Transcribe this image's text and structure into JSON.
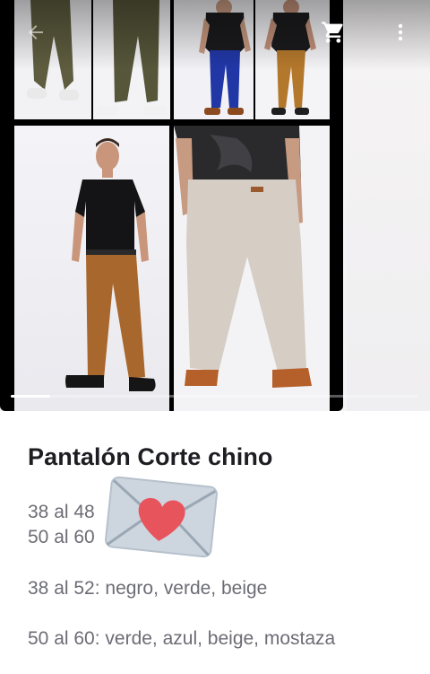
{
  "app": {
    "icons": {
      "back": "arrow-back-icon",
      "cart": "shopping-cart-icon",
      "more": "more-vert-icon"
    }
  },
  "gallery": {
    "slide_index": 1,
    "panels": [
      {
        "name": "olive-pants-sneakers",
        "shirt": "none",
        "pants": "#5e5d3f",
        "shoes": "#e9e9e9"
      },
      {
        "name": "olive-pants-white-shoes",
        "shirt": "none",
        "pants": "#56563a",
        "shoes": "#f1f1f1"
      },
      {
        "name": "blue-pants-black-tee",
        "shirt": "#1b1b1d",
        "pants": "#2137a6",
        "shoes": "#8b4a1f"
      },
      {
        "name": "mustard-pants-black-tee",
        "shirt": "#1b1b1d",
        "pants": "#b4782c",
        "shoes": "#1e1e1e"
      },
      {
        "name": "model-mustard-chinos",
        "shirt": "#141416",
        "pants": "#a8672c",
        "shoes": "#151515"
      },
      {
        "name": "beige-chinos-back-view",
        "shirt": "#2a2a2c",
        "pants": "#d6cdc5",
        "shoes": "#b55f2a"
      }
    ]
  },
  "product": {
    "title": "Pantalón Corte chino",
    "emoji": "love-letter-icon",
    "lines": [
      "38 al 48",
      "50 al 60",
      "38 al 52: negro, verde, beige",
      "50 al 60: verde, azul, beige, mostaza"
    ]
  },
  "colors": {
    "title_text": "#1d1d22",
    "body_text": "#6c6c75",
    "heart": "#e8545c",
    "envelope": "#cdd6df"
  }
}
